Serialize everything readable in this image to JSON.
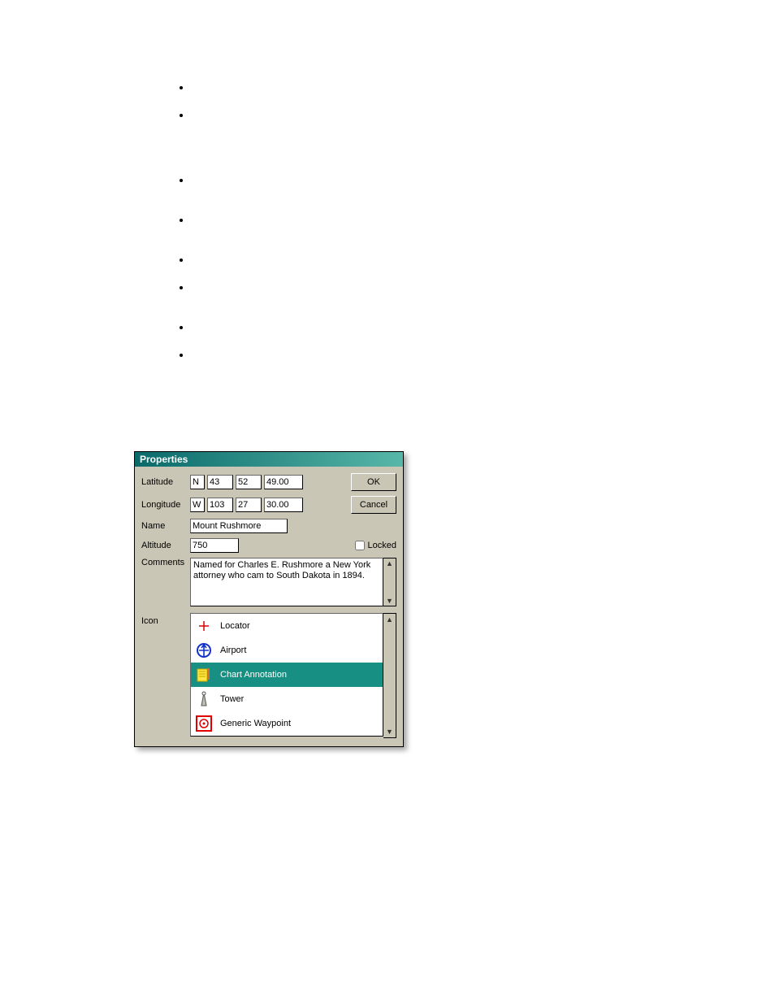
{
  "dialog": {
    "title": "Properties",
    "labels": {
      "latitude": "Latitude",
      "longitude": "Longitude",
      "name": "Name",
      "altitude": "Altitude",
      "comments": "Comments",
      "icon": "Icon",
      "locked": "Locked"
    },
    "latitude": {
      "hemi": "N",
      "deg": "43",
      "min": "52",
      "sec": "49.00"
    },
    "longitude": {
      "hemi": "W",
      "deg": "103",
      "min": "27",
      "sec": "30.00"
    },
    "name": "Mount Rushmore",
    "altitude": "750",
    "locked": false,
    "comments": "Named for Charles E. Rushmore a New York attorney who cam to South Dakota in 1894.",
    "buttons": {
      "ok": "OK",
      "cancel": "Cancel"
    },
    "icons": [
      {
        "id": "locator",
        "label": "Locator"
      },
      {
        "id": "airport",
        "label": "Airport"
      },
      {
        "id": "chart-annotation",
        "label": "Chart Annotation",
        "selected": true
      },
      {
        "id": "tower",
        "label": "Tower"
      },
      {
        "id": "generic-waypoint",
        "label": "Generic Waypoint"
      }
    ]
  }
}
